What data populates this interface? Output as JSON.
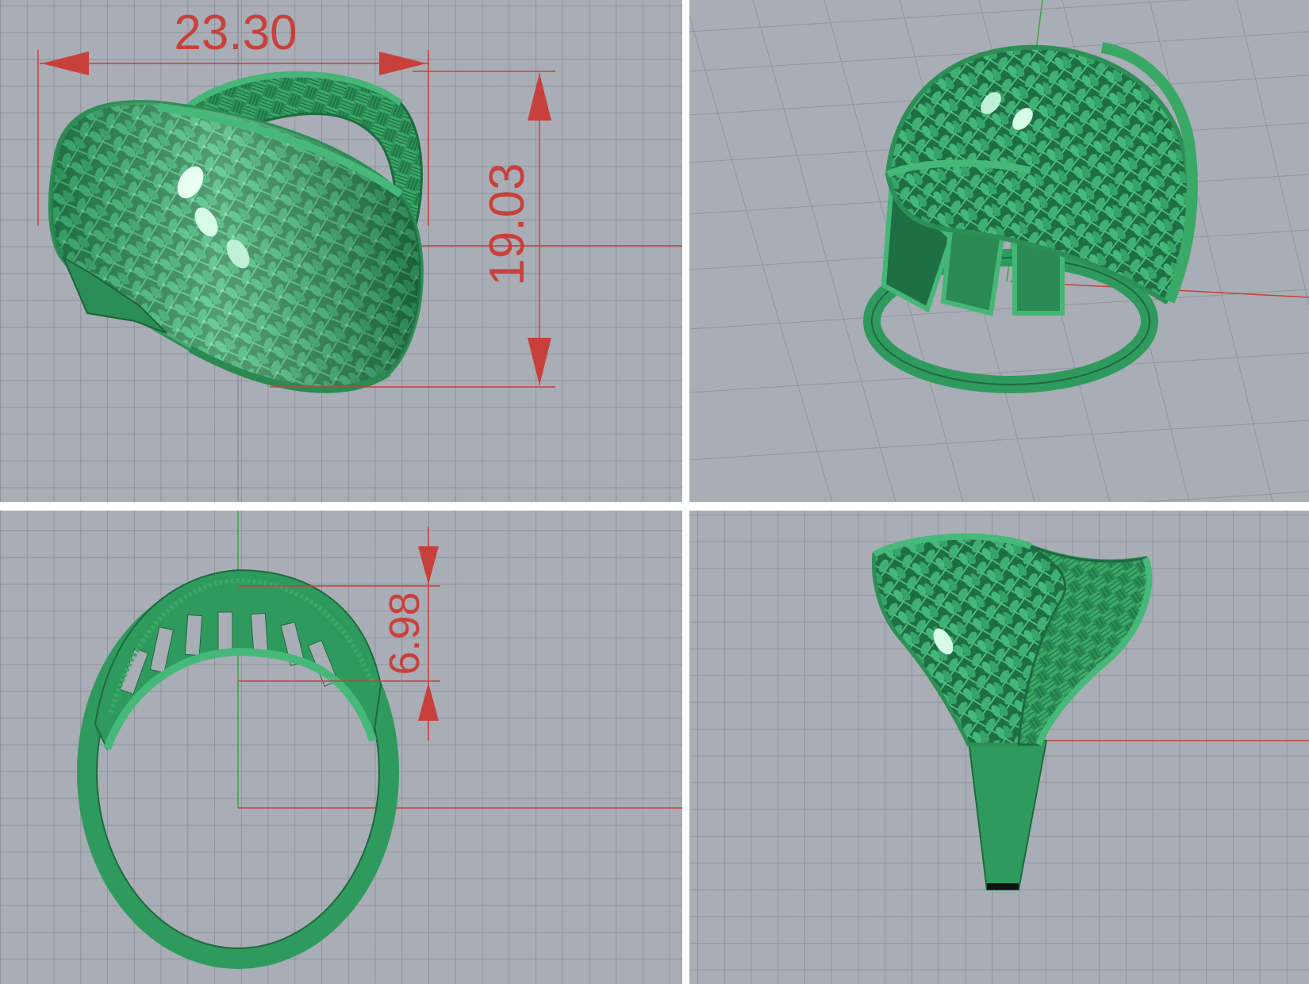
{
  "colors": {
    "viewport_background": "#a9adb5",
    "grid_line": "#7f848d",
    "ring_green": "#2f9a5e",
    "dimension_red": "#c8403c",
    "x_axis": "#c8403c",
    "y_axis": "#3aa64a",
    "divider": "#ffffff"
  },
  "viewports": {
    "top_left": {
      "view": "perspective-top",
      "dimensions": {
        "width_label": "23.30",
        "height_label": "19.03"
      }
    },
    "top_right": {
      "view": "perspective"
    },
    "bottom_left": {
      "view": "front",
      "dimensions": {
        "thickness_label": "6.98"
      }
    },
    "bottom_right": {
      "view": "right"
    }
  },
  "model": {
    "description_icon": "filigree-ring-icon"
  }
}
